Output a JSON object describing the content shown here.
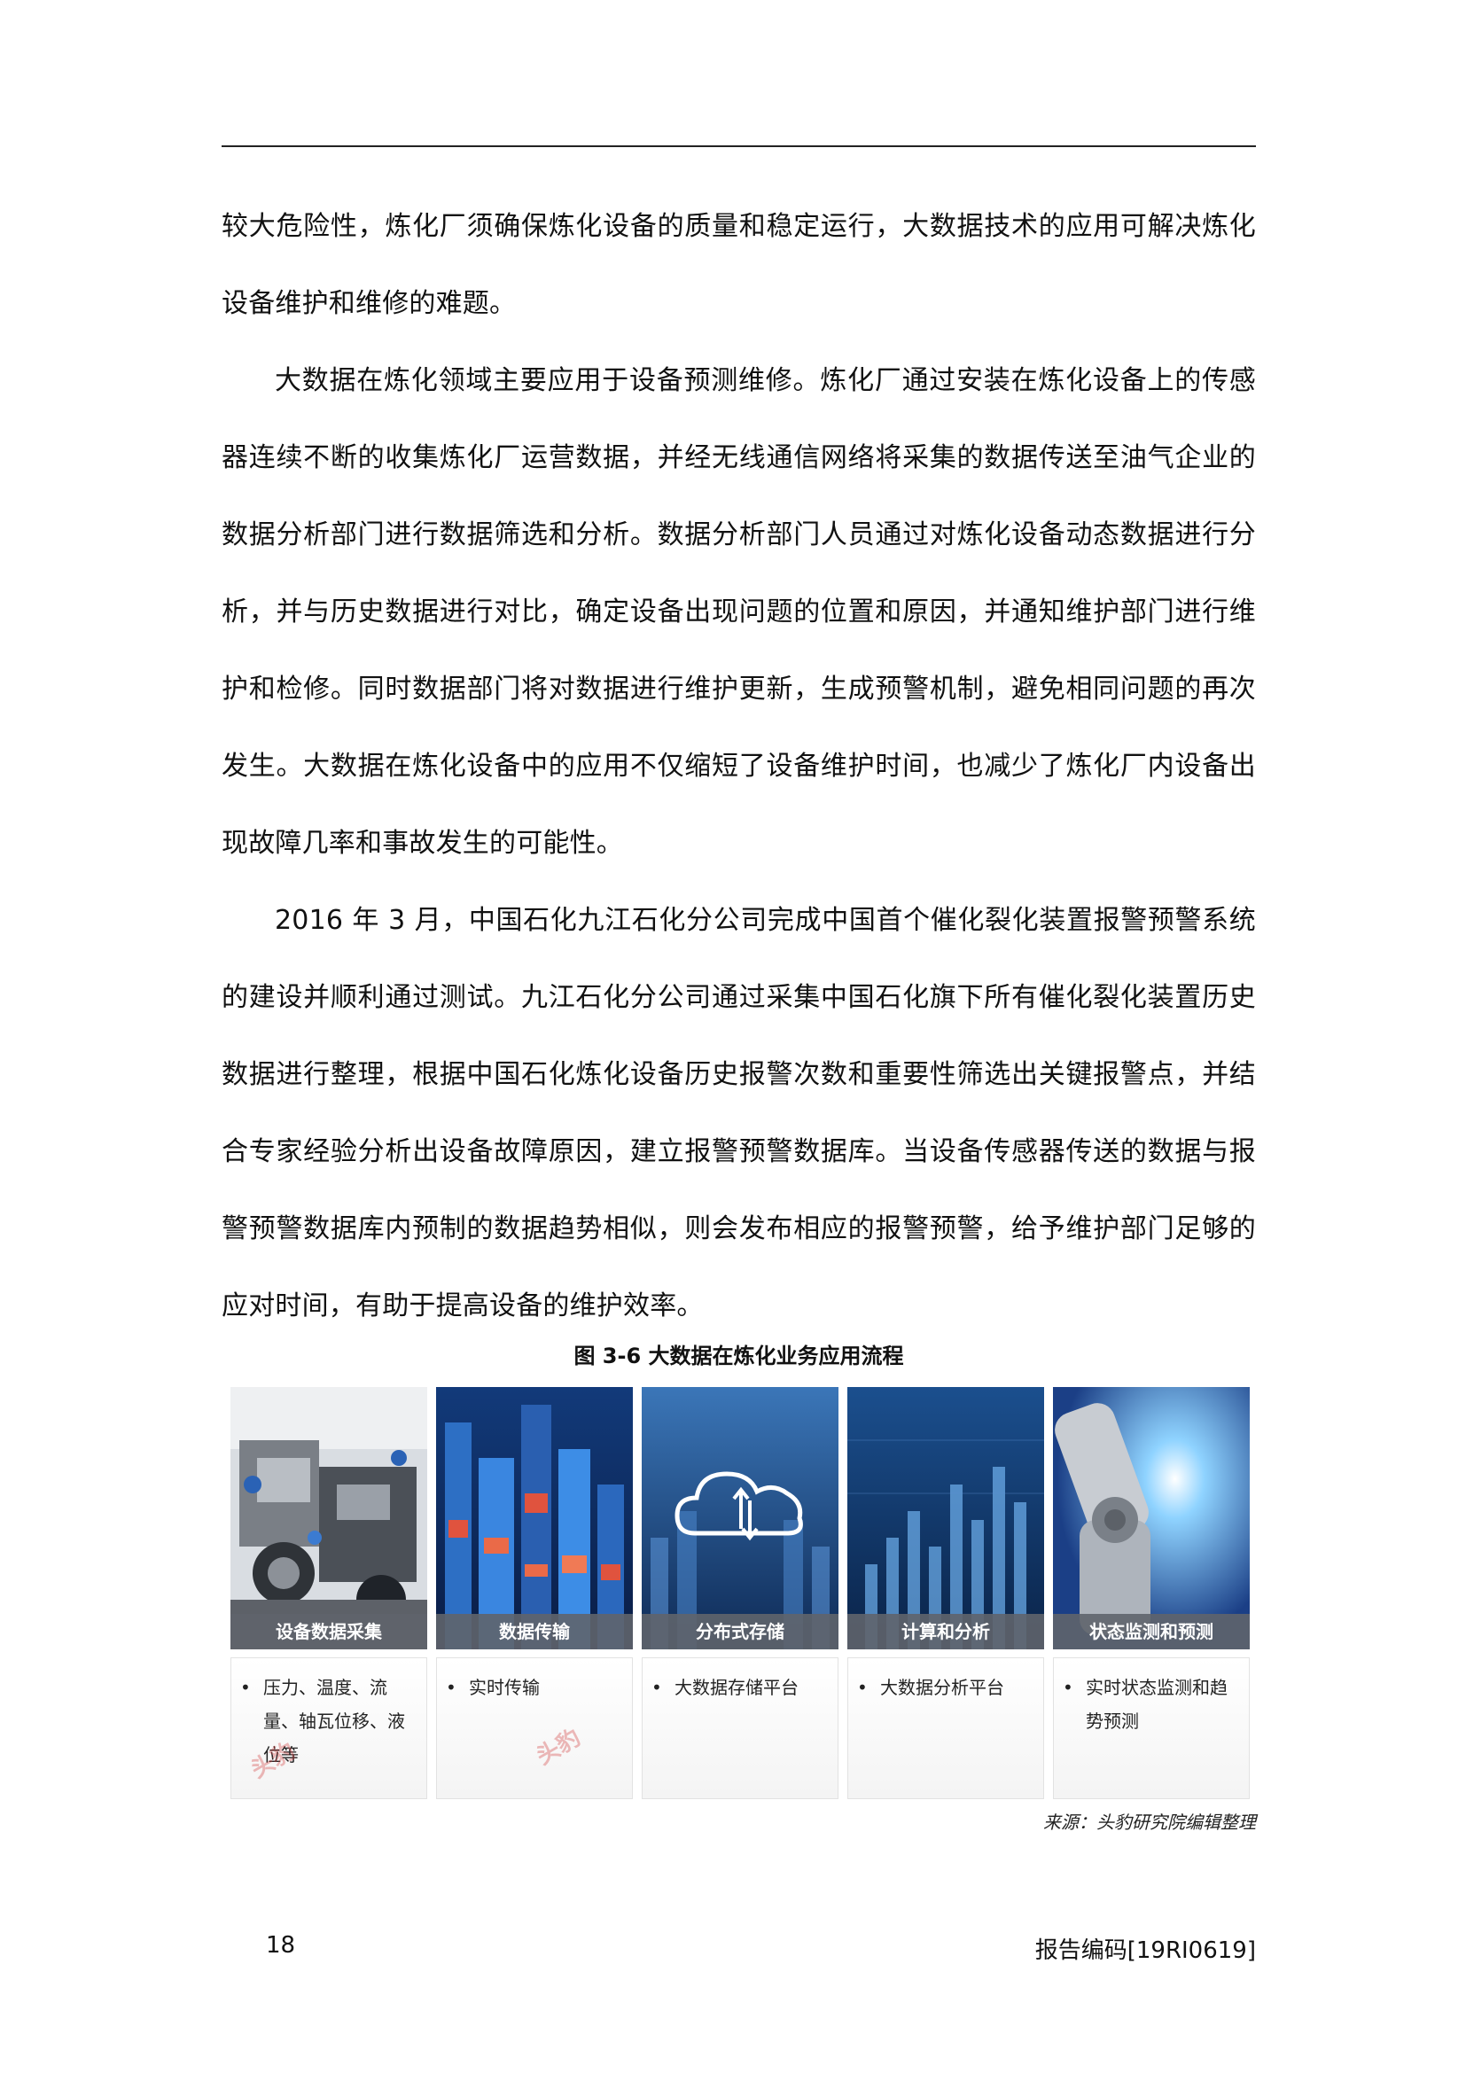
{
  "paragraphs": [
    {
      "text": "较大危险性，炼化厂须确保炼化设备的质量和稳定运行，大数据技术的应用可解决炼化设备维护和维修的难题。",
      "indent": false
    },
    {
      "text": "大数据在炼化领域主要应用于设备预测维修。炼化厂通过安装在炼化设备上的传感器连续不断的收集炼化厂运营数据，并经无线通信网络将采集的数据传送至油气企业的数据分析部门进行数据筛选和分析。数据分析部门人员通过对炼化设备动态数据进行分析，并与历史数据进行对比，确定设备出现问题的位置和原因，并通知维护部门进行维护和检修。同时数据部门将对数据进行维护更新，生成预警机制，避免相同问题的再次发生。大数据在炼化设备中的应用不仅缩短了设备维护时间，也减少了炼化厂内设备出现故障几率和事故发生的可能性。",
      "indent": true
    },
    {
      "text": "2016 年 3 月，中国石化九江石化分公司完成中国首个催化裂化装置报警预警系统的建设并顺利通过测试。九江石化分公司通过采集中国石化旗下所有催化裂化装置历史数据进行整理，根据中国石化炼化设备历史报警次数和重要性筛选出关键报警点，并结合专家经验分析出设备故障原因，建立报警预警数据库。当设备传感器传送的数据与报警预警数据库内预制的数据趋势相似，则会发布相应的报警预警，给予维护部门足够的应对时间，有助于提高设备的维护效率。",
      "indent": true
    }
  ],
  "figure": {
    "caption": "图 3-6  大数据在炼化业务应用流程",
    "watermark": "头豹",
    "panels": [
      {
        "label": "设备数据采集",
        "bullet": "•",
        "text": "压力、温度、流量、轴瓦位移、液位等",
        "icon": "machinery-photo"
      },
      {
        "label": "数据传输",
        "bullet": "•",
        "text": "实时传输",
        "icon": "city-data-photo"
      },
      {
        "label": "分布式存储",
        "bullet": "•",
        "text": "大数据存储平台",
        "icon": "cloud-icon"
      },
      {
        "label": "计算和分析",
        "bullet": "•",
        "text": "大数据分析平台",
        "icon": "bar-chart-photo"
      },
      {
        "label": "状态监测和预测",
        "bullet": "•",
        "text": "实时状态监测和趋势预测",
        "icon": "robot-arm-photo"
      }
    ]
  },
  "source": "来源：头豹研究院编辑整理",
  "footer": {
    "page_number": "18",
    "report_code": "报告编码[19RI0619]"
  }
}
